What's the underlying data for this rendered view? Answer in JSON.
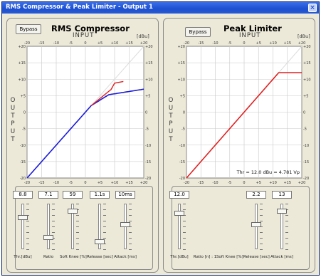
{
  "window": {
    "title": "RMS Compressor & Peak Limiter - Output 1",
    "close_glyph": "×"
  },
  "compressor": {
    "title": "RMS Compressor",
    "bypass": "Bypass",
    "input_label": "INPUT",
    "unit": "[dBu]",
    "output_label": [
      "O",
      "U",
      "T",
      "P",
      "U",
      "T"
    ],
    "x_ticks_top": [
      "-20",
      "-15",
      "-10",
      "-5",
      "0",
      "+5",
      "+10",
      "+15",
      "+20"
    ],
    "x_ticks_bottom": [
      "-20",
      "-15",
      "-10",
      "-5",
      "0",
      "+5",
      "+10",
      "+15",
      "+20"
    ],
    "y_ticks_left": [
      "+20",
      "+15",
      "+10",
      "+5",
      "0",
      "-5",
      "-10",
      "-15",
      "-20"
    ],
    "y_ticks_right": [
      "+20",
      "+15",
      "+10",
      "+5",
      "0",
      "-5",
      "-10",
      "-15",
      "-20"
    ],
    "controls": [
      {
        "value": "8.8",
        "label": "Thr.[dBu]",
        "level": 0.72
      },
      {
        "value": "7.1",
        "label": "Ratio",
        "level": 0.22
      },
      {
        "value": "59",
        "label": "Soft Knee [%]",
        "level": 0.88
      },
      {
        "value": "1.1s",
        "label": "Release [sec]",
        "level": 0.12
      },
      {
        "value": "10ms",
        "label": "Attack [ms]",
        "level": 0.55
      }
    ],
    "colors": {
      "blue": "#1a1ad8",
      "red": "#e02020"
    }
  },
  "limiter": {
    "title": "Peak Limiter",
    "bypass": "Bypass",
    "input_label": "INPUT",
    "unit": "[dBu]",
    "output_label": [
      "O",
      "U",
      "T",
      "P",
      "U",
      "T"
    ],
    "x_ticks_top": [
      "-20",
      "-15",
      "-10",
      "-5",
      "0",
      "+5",
      "+10",
      "+15",
      "+20"
    ],
    "x_ticks_bottom": [
      "-20",
      "-15",
      "-10",
      "-5",
      "0",
      "+5",
      "+10",
      "+15",
      "+20"
    ],
    "y_ticks_left": [
      "+20",
      "+15",
      "+10",
      "+5",
      "0",
      "-5",
      "-10",
      "-15",
      "-20"
    ],
    "y_ticks_right": [
      "+20",
      "+15",
      "+10",
      "+5",
      "0",
      "-5",
      "-10",
      "-15",
      "-20"
    ],
    "threshold_text": "Thr = 12.0 dBu = 4.781 Vp",
    "controls": [
      {
        "value": "12.0",
        "label": "Thr.[dBu]",
        "level": 0.82
      },
      {
        "value": "",
        "label": "Ratio [n] : 1",
        "level": null
      },
      {
        "value": "",
        "label": "Soft Knee [%]",
        "level": null
      },
      {
        "value": "2.2",
        "label": "Release [sec]",
        "level": 0.55
      },
      {
        "value": "13",
        "label": "Attack [ms]",
        "level": 0.88
      }
    ]
  }
}
